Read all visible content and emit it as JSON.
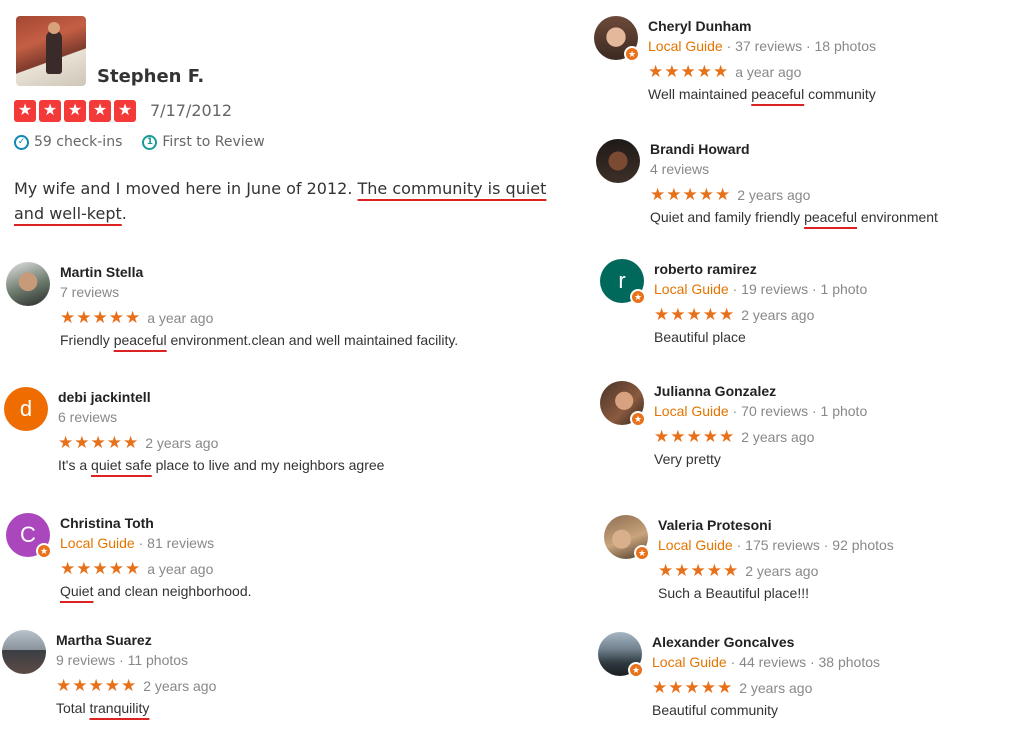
{
  "yelp": {
    "name": "Stephen F.",
    "stars": "★",
    "date": "7/17/2012",
    "checkins": "59 check-ins",
    "first_review": "First to Review",
    "text_before": "My wife and I moved here in June of 2012. ",
    "text_highlight": "The community is quiet and well-kept",
    "text_after": "."
  },
  "reviews": [
    {
      "name": "Martin Stella",
      "guide": "",
      "stats": "7 reviews",
      "stars": "★★★★★",
      "time": "a year ago",
      "text_before": "Friendly ",
      "text_highlight": "peaceful",
      "text_after": " environment.clean and well maintained facility."
    },
    {
      "name": "debi jackintell",
      "guide": "",
      "stats": "6 reviews",
      "stars": "★★★★★",
      "time": "2 years ago",
      "avatar_letter": "d",
      "text_before": "It's a ",
      "text_highlight": "quiet safe",
      "text_after": " place to live and my neighbors agree"
    },
    {
      "name": "Christina Toth",
      "guide": "Local Guide",
      "stats": " · 81 reviews",
      "stars": "★★★★★",
      "time": "a year ago",
      "avatar_letter": "C",
      "text_before": "",
      "text_highlight": "Quiet",
      "text_after": " and clean neighborhood."
    },
    {
      "name": "Martha Suarez",
      "guide": "",
      "stats": "9 reviews · 11 photos",
      "stars": "★★★★★",
      "time": "2 years ago",
      "text_before": "Total ",
      "text_highlight": "tranquility",
      "text_after": ""
    },
    {
      "name": "Cheryl Dunham",
      "guide": "Local Guide",
      "stats": " · 37 reviews · 18 photos",
      "stars": "★★★★★",
      "time": "a year ago",
      "text_before": "Well maintained ",
      "text_highlight": "peaceful",
      "text_after": " community"
    },
    {
      "name": "Brandi Howard",
      "guide": "",
      "stats": "4 reviews",
      "stars": "★★★★★",
      "time": "2 years ago",
      "text_before": "Quiet and family friendly ",
      "text_highlight": "peaceful",
      "text_after": " environment"
    },
    {
      "name": "roberto ramirez",
      "guide": "Local Guide",
      "stats": " · 19 reviews · 1 photo",
      "stars": "★★★★★",
      "time": "2 years ago",
      "avatar_letter": "r",
      "text_before": "Beautiful place",
      "text_highlight": "",
      "text_after": ""
    },
    {
      "name": "Julianna Gonzalez",
      "guide": "Local Guide",
      "stats": " · 70 reviews · 1 photo",
      "stars": "★★★★★",
      "time": "2 years ago",
      "text_before": "Very pretty",
      "text_highlight": "",
      "text_after": ""
    },
    {
      "name": "Valeria Protesoni",
      "guide": "Local Guide",
      "stats": " · 175 reviews · 92 photos",
      "stars": "★★★★★",
      "time": "2 years ago",
      "text_before": "Such a Beautiful place!!!",
      "text_highlight": "",
      "text_after": ""
    },
    {
      "name": "Alexander Goncalves",
      "guide": "Local Guide",
      "stats": " · 44 reviews · 38 photos",
      "stars": "★★★★★",
      "time": "2 years ago",
      "text_before": "Beautiful community",
      "text_highlight": "",
      "text_after": ""
    }
  ],
  "colors": {
    "yelp_star": "#f43939",
    "google_star": "#e7711b",
    "local_guide": "#e37400",
    "highlight_underline": "#dd2222"
  }
}
